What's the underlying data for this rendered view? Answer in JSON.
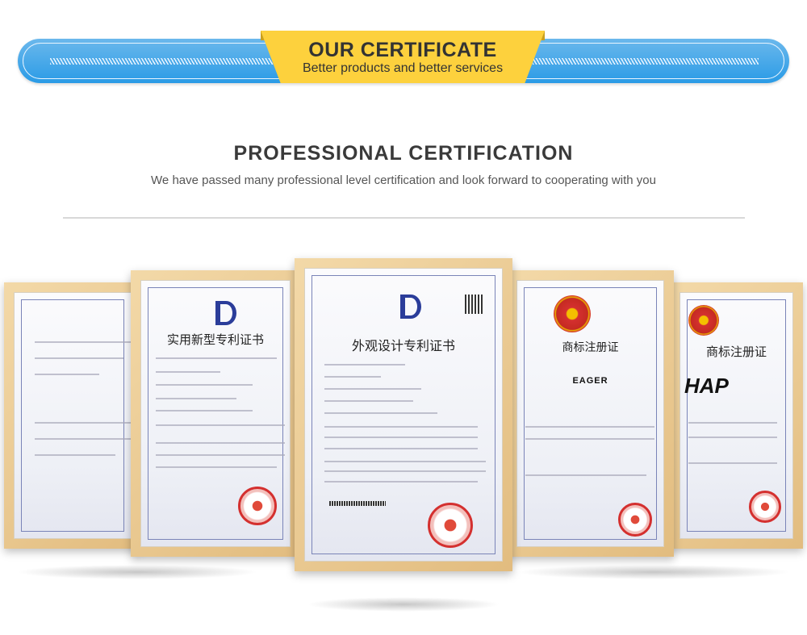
{
  "banner": {
    "title": "OUR CERTIFICATE",
    "subtitle": "Better products and better services"
  },
  "section": {
    "title": "PROFESSIONAL CERTIFICATION",
    "subtitle": "We have passed many professional level certification and look forward to cooperating with you"
  },
  "certificates": [
    {
      "type": "utility-patent",
      "title": ""
    },
    {
      "type": "utility-patent",
      "title": "实用新型专利证书"
    },
    {
      "type": "design-patent",
      "title": "外观设计专利证书"
    },
    {
      "type": "trademark",
      "title": "商标注册证",
      "brand": "EAGER"
    },
    {
      "type": "trademark",
      "title": "商标注册证",
      "brand": "HAP"
    }
  ],
  "colors": {
    "banner_blue": "#2a9be6",
    "ribbon_yellow": "#fdd13d",
    "frame_wood": "#e2bc7f",
    "seal_red": "#d4302f"
  }
}
